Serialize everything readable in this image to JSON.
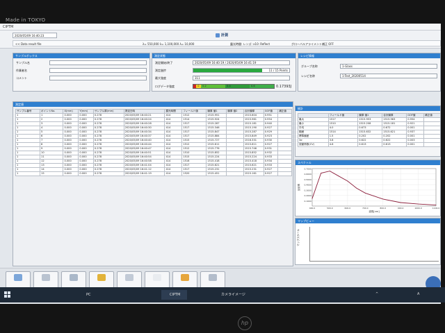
{
  "brand": "Made in TOKYO",
  "app": {
    "title": "CIPTM",
    "date": "2020/05/09 16:40:23",
    "measure_title": "計測",
    "info": {
      "data_source": "<< Data result file",
      "wave": "λ= 550,000  λ= 1,100,000  λ= 10,000",
      "sensitivity": "露光時間: レンズ:  x10: Reflect",
      "calibration": "グローバルアライメント補正 OFF"
    }
  },
  "sample_panel": {
    "header": "サンプルボックス",
    "labels": [
      "サンプル名",
      "作業者名",
      "コメント"
    ]
  },
  "measure_panel": {
    "header": "測定状態",
    "labels": {
      "start_end": "測定開始/終了",
      "status": "測定進捗",
      "max_value": "最大強度",
      "gauge": "ログデータ強度"
    },
    "start_end_value": "2020/05/09 16:40:19  /  2020/05/09 16:41:19",
    "progress": 0.72,
    "progress_text": "11 / 15 Points",
    "max_value_text": "311",
    "gauge_value": "0.17393J",
    "gauge_colors": [
      "#d22525",
      "#f0d328",
      "#5fbf3a",
      "#2f9b3a",
      "#3fae4a"
    ],
    "gauge_ticks": [
      "0",
      "0.2",
      "0.4",
      "0.6",
      "0.8"
    ]
  },
  "reg_panel": {
    "header": "レシピ情報",
    "labels": [
      "グループ名称",
      "レシピ名称"
    ],
    "values": [
      "1-Glass",
      "1-Test_20200514"
    ]
  },
  "data_table": {
    "header": "測定値",
    "columns": [
      "サンプル番号",
      "ポイントNo.",
      "X(mm)",
      "Y(mm)",
      "サンプル厚(mm)",
      "測定日時",
      "露光時間",
      "フィールド値",
      "膜厚 値1",
      "膜厚 値2",
      "合計膜厚",
      "GOF値",
      "補正値"
    ],
    "rows": [
      [
        "1",
        "1",
        "0.000",
        "0.000",
        "0.278",
        "2020/05/09 16:40:21",
        "414",
        "1512",
        "1515.951",
        "",
        "1515.604",
        "0.951",
        ""
      ],
      [
        "1",
        "2",
        "0.000",
        "0.000",
        "0.278",
        "2020/05/09 16:40:24",
        "414",
        "1514",
        "1515.924",
        "",
        "1515.961",
        "0.954",
        ""
      ],
      [
        "1",
        "3",
        "0.000",
        "0.000",
        "0.278",
        "2020/05/09 16:40:28",
        "414",
        "1517",
        "1515.287",
        "",
        "1515.181",
        "0.940",
        ""
      ],
      [
        "1",
        "4",
        "0.000",
        "0.000",
        "0.278",
        "2020/05/09 16:40:30",
        "414",
        "1517",
        "1515.346",
        "",
        "1515.190",
        "0.927",
        ""
      ],
      [
        "1",
        "5",
        "0.000",
        "0.000",
        "0.278",
        "2020/05/09 16:40:34",
        "414",
        "1517",
        "1515.847",
        "",
        "1515.287",
        "0.929",
        ""
      ],
      [
        "1",
        "6",
        "0.000",
        "0.000",
        "0.278",
        "2020/05/09 16:40:37",
        "414",
        "1517",
        "1515.884",
        "",
        "1515.849",
        "0.923",
        ""
      ],
      [
        "1",
        "7",
        "0.000",
        "0.000",
        "0.278",
        "2020/05/09 16:40:40",
        "414",
        "1515",
        "1515.727",
        "",
        "1516.331",
        "0.930",
        ""
      ],
      [
        "1",
        "8",
        "0.000",
        "0.000",
        "0.278",
        "2020/05/09 16:40:44",
        "414",
        "1512",
        "1515.611",
        "",
        "1515.611",
        "0.927",
        ""
      ],
      [
        "1",
        "9",
        "0.000",
        "0.000",
        "0.278",
        "2020/05/09 16:40:47",
        "414",
        "1512",
        "1515.776",
        "",
        "1515.746",
        "0.931",
        ""
      ],
      [
        "1",
        "10",
        "0.000",
        "0.000",
        "0.278",
        "2020/05/09 16:40:51",
        "414",
        "1510",
        "1515.852",
        "",
        "1515.852",
        "0.932",
        ""
      ],
      [
        "1",
        "11",
        "0.000",
        "0.000",
        "0.278",
        "2020/05/09 16:40:54",
        "414",
        "1515",
        "1515.224",
        "",
        "1515.224",
        "0.933",
        ""
      ],
      [
        "1",
        "12",
        "0.000",
        "0.000",
        "0.278",
        "2020/05/09 16:40:58",
        "414",
        "1516",
        "1515.418",
        "",
        "1515.418",
        "0.934",
        ""
      ],
      [
        "1",
        "13",
        "0.000",
        "0.000",
        "0.278",
        "2020/05/09 16:41:04",
        "414",
        "1517",
        "1515.621",
        "",
        "1515.621",
        "0.933",
        ""
      ],
      [
        "1",
        "14",
        "0.000",
        "0.000",
        "0.278",
        "2020/05/09 16:41:12",
        "414",
        "1517",
        "1515.231",
        "",
        "1515.231",
        "0.927",
        ""
      ],
      [
        "1",
        "15",
        "0.000",
        "0.000",
        "0.278",
        "2020/05/09 16:41:19",
        "414",
        "1520",
        "1515.451",
        "",
        "1515.161",
        "0.927",
        ""
      ]
    ]
  },
  "stats_panel": {
    "header": "統計",
    "columns": [
      "",
      "フィールド値",
      "膜厚 値1",
      "合計膜厚",
      "GOF値",
      "補正値"
    ],
    "rows": [
      [
        "最大",
        "1517",
        "1515.953",
        "1515.963",
        "0.954",
        ""
      ],
      [
        "最小",
        "1510",
        "1515.208",
        "1515.181",
        "0.921",
        ""
      ],
      [
        "平均",
        "4.0",
        "0.673",
        "0.672",
        "0.001",
        ""
      ],
      [
        "範囲",
        "1514",
        "1515.632",
        "1515.621",
        "0.937",
        ""
      ],
      [
        "標準偏差",
        "1.5",
        "0.202",
        "0.202",
        "0.001",
        ""
      ],
      [
        "3σ",
        "3.8",
        "0.622",
        "0.622",
        "0.003",
        ""
      ],
      [
        "変動係数(CV)",
        "4.6",
        "0.613",
        "0.613",
        "0.001",
        ""
      ]
    ]
  },
  "chart_panel": {
    "header": "スペクトル"
  },
  "chart_data": {
    "type": "line",
    "x": [
      400,
      450,
      500,
      550,
      600,
      650,
      700,
      800,
      900,
      1000,
      1100
    ],
    "values": [
      0.15,
      0.66,
      0.7,
      0.6,
      0.5,
      0.36,
      0.26,
      0.14,
      0.07,
      0.04,
      0.02
    ],
    "ylabel": "反射率",
    "xlabel": "波長[nm]",
    "xticks": [
      "400.0",
      "500.0",
      "600.0",
      "700.0",
      "800.0",
      "900.0",
      "1000.0",
      "1100.0"
    ],
    "yticks": [
      "0.7000",
      "0.6000",
      "0.5000",
      "0.4000",
      "0.3000",
      "0.2000",
      "0.1000"
    ],
    "xlim": [
      400,
      1100
    ],
    "ylim": [
      0,
      0.75
    ],
    "grid": true,
    "line_color": "#8b1d3a"
  },
  "map_panel": {
    "header": "マップビュー",
    "ylabel": "マップスケール"
  },
  "toolbar": {
    "buttons": [
      {
        "label": "開始",
        "color": "#7ca6d9"
      },
      {
        "label": "停止",
        "color": "#b9c3d0"
      },
      {
        "label": "設定",
        "color": "#aab8c9"
      },
      {
        "label": "レシピ管理",
        "color": "#e2b33a"
      },
      {
        "label": "レシピ作成",
        "color": "#c2cad6"
      },
      {
        "label": "CSV出力",
        "color": "#e9ecf0"
      },
      {
        "label": "レシピ保存",
        "color": "#e6a63c"
      },
      {
        "label": "ツール設定",
        "color": "#b3bdcb"
      }
    ]
  },
  "taskbar": {
    "items": [
      "PC",
      "CIPTM",
      "カメライメージ"
    ],
    "tray": [
      "^",
      "A"
    ]
  },
  "bezel_logo": "hp"
}
